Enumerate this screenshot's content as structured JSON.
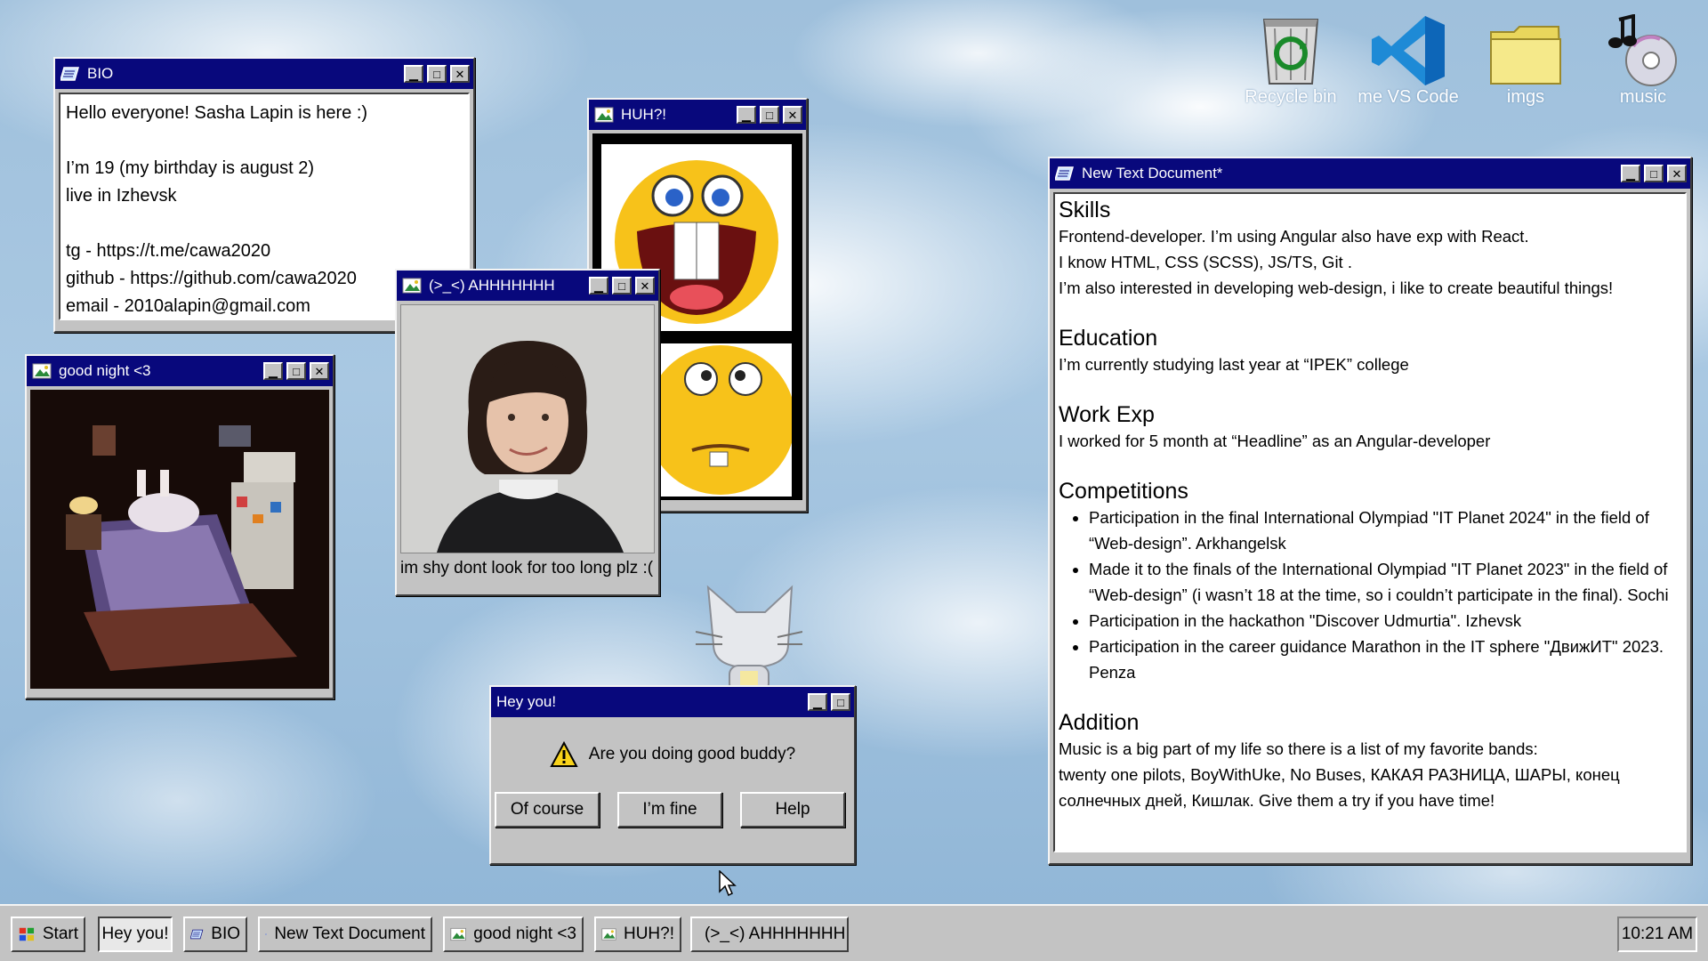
{
  "desktop": {
    "icons": [
      {
        "label": "Recycle bin",
        "icon": "recycle-bin-icon"
      },
      {
        "label": "me VS Code",
        "icon": "vscode-icon"
      },
      {
        "label": "imgs",
        "icon": "folder-icon"
      },
      {
        "label": "music",
        "icon": "music-icon"
      }
    ]
  },
  "bio": {
    "title": "BIO",
    "lines": [
      "Hello everyone! Sasha Lapin is here :)",
      "",
      "I’m 19 (my birthday is august 2)",
      "live in Izhevsk",
      "",
      "tg - https://t.me/cawa2020",
      "github - https://github.com/cawa2020",
      "email - 2010alapin@gmail.com"
    ]
  },
  "goodnight": {
    "title": "good night <3"
  },
  "huh": {
    "title": "HUH?!"
  },
  "ahh": {
    "title": "(>_<) AHHHHHHH",
    "caption": "im shy dont look for too long plz :("
  },
  "dialog": {
    "title": "Hey you!",
    "message": "Are you doing good buddy?",
    "buttons": [
      "Of course",
      "I’m fine",
      "Help"
    ]
  },
  "doc": {
    "title": "New Text Document*",
    "skills": {
      "heading": "Skills",
      "lines": [
        "Frontend-developer. I’m using Angular also have exp with React.",
        "I know HTML, CSS (SCSS), JS/TS, Git .",
        "I’m also interested in developing web-design, i like to create beautiful things!"
      ]
    },
    "education": {
      "heading": "Education",
      "text": "I’m currently studying last year at “IPEK” college"
    },
    "work": {
      "heading": "Work Exp",
      "text": "I worked for 5 month at “Headline” as an Angular-developer"
    },
    "competitions": {
      "heading": "Competitions",
      "items": [
        "Participation in the final International Olympiad \"IT Planet 2024\" in the field of “Web-design”. Arkhangelsk",
        "Made it to the finals of the International Olympiad \"IT Planet 2023\" in the field of “Web-design” (i wasn’t 18 at the time, so i couldn’t participate in the final). Sochi",
        "Participation in the hackathon \"Discover Udmurtia\". Izhevsk",
        "Participation in the career guidance Marathon in the IT sphere \"ДвижИТ\" 2023. Penza"
      ]
    },
    "addition": {
      "heading": "Addition",
      "line1": "Music is a big part of my life so there is a list of my favorite bands:",
      "line2": "twenty one pilots, BoyWithUke, No Buses, КАКАЯ РАЗНИЦА, ШАРЫ, конец солнечных дней, Кишлак. Give them a try if you have time!"
    }
  },
  "taskbar": {
    "start": "Start",
    "tasks": [
      "Hey you!",
      "BIO",
      "New Text Document",
      "good night <3",
      "HUH?!",
      "(>_<) AHHHHHHH"
    ],
    "clock": "10:21 AM"
  }
}
